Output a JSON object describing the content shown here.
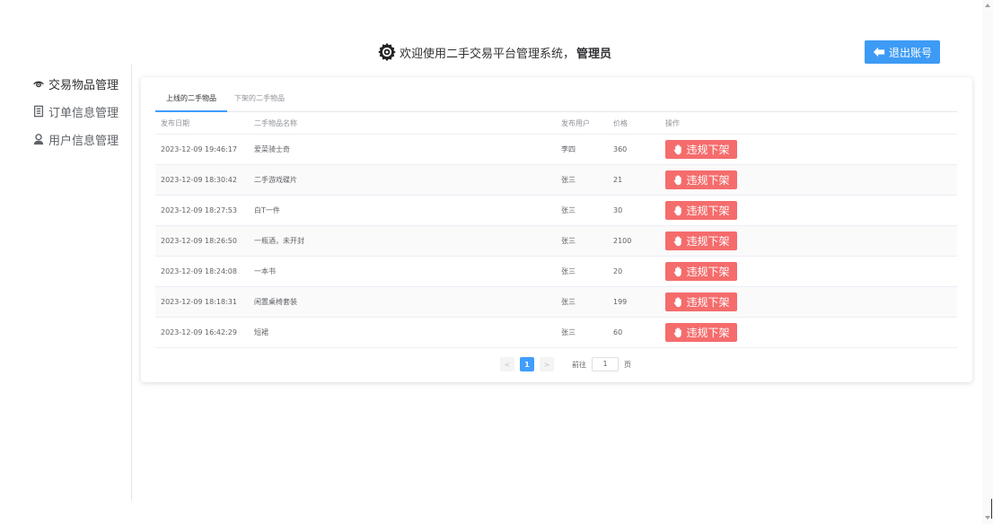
{
  "header": {
    "title": "欢迎使用二手交易平台管理系统，",
    "role": "管理员",
    "logout_label": "退出账号"
  },
  "sidebar": {
    "items": [
      {
        "label": "交易物品管理",
        "icon": "eye-icon",
        "active": true
      },
      {
        "label": "订单信息管理",
        "icon": "document-icon",
        "active": false
      },
      {
        "label": "用户信息管理",
        "icon": "user-icon",
        "active": false
      }
    ]
  },
  "tabs": [
    {
      "label": "上线的二手物品",
      "active": true
    },
    {
      "label": "下架的二手物品",
      "active": false
    }
  ],
  "table": {
    "columns": [
      "发布日期",
      "二手物品名称",
      "发布用户",
      "价格",
      "操作"
    ],
    "rows": [
      {
        "date": "2023-12-09 19:46:17",
        "name": "爱菜骑士奇",
        "user": "李四",
        "price": "360",
        "action": "违规下架"
      },
      {
        "date": "2023-12-09 18:30:42",
        "name": "二手游戏碟片",
        "user": "张三",
        "price": "21",
        "action": "违规下架"
      },
      {
        "date": "2023-12-09 18:27:53",
        "name": "白T一件",
        "user": "张三",
        "price": "30",
        "action": "违规下架"
      },
      {
        "date": "2023-12-09 18:26:50",
        "name": "一瓶酒，未开封",
        "user": "张三",
        "price": "2100",
        "action": "违规下架"
      },
      {
        "date": "2023-12-09 18:24:08",
        "name": "一本书",
        "user": "张三",
        "price": "20",
        "action": "违规下架"
      },
      {
        "date": "2023-12-09 18:18:31",
        "name": "闲置桌椅套装",
        "user": "张三",
        "price": "199",
        "action": "违规下架"
      },
      {
        "date": "2023-12-09 16:42:29",
        "name": "短裙",
        "user": "张三",
        "price": "60",
        "action": "违规下架"
      }
    ]
  },
  "pagination": {
    "prev": "<",
    "current": "1",
    "next": ">",
    "goto_prefix": "前往",
    "goto_value": "1",
    "goto_suffix": "页"
  },
  "colors": {
    "accent": "#409eff",
    "danger": "#f56c6c",
    "logout": "#3d9bf5"
  }
}
